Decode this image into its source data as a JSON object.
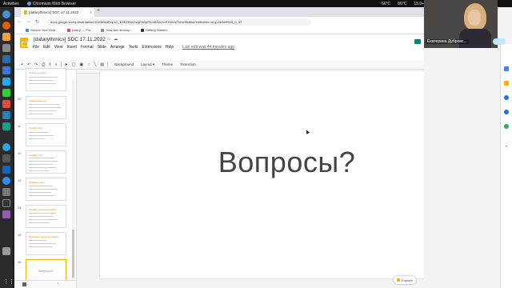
{
  "topbar": {
    "activities": "Activities",
    "app_name": "Chromium Web Browser",
    "status": [
      "66°C",
      "86°C",
      "15.0+"
    ]
  },
  "browser": {
    "tab_title": "[datarythmics] SDC 17.11.2022",
    "tab_close": "×",
    "new_tab": "+",
    "url": "docs.google.com/presentation/d/1K5D6aRnjrsC_E8EZbVaGvgZ4t0pPSmDWc2v-EVWvVTkhie6fs6tke/edit#slide=id.g19b0dfff330_0_57",
    "bookmarks": [
      {
        "label": "Secure Your Cold ...",
        "color": "#4285f4"
      },
      {
        "label": "pluto.jl — Plu...",
        "color": "#e44"
      },
      {
        "label": "How are develop...",
        "color": "#888"
      },
      {
        "label": "Getting Started...",
        "color": "#333"
      }
    ]
  },
  "slides": {
    "title": "[datarythmics] SDC 17.11.2022",
    "menu": [
      "File",
      "Edit",
      "View",
      "Insert",
      "Format",
      "Slide",
      "Arrange",
      "Tools",
      "Extensions",
      "Help"
    ],
    "last_edit": "Last edit was 44 minutes ago",
    "toolbar": {
      "background": "Background",
      "layout": "Layout ▾",
      "theme": "Theme",
      "transition": "Transition"
    },
    "thumbnails": [
      {
        "num": "",
        "title": "Плюсы ошибки",
        "lines": 3
      },
      {
        "num": "10",
        "title": "Главная мысль",
        "lines": 4
      },
      {
        "num": "11",
        "title": "Ошибки (HL)",
        "lines": 3
      },
      {
        "num": "12",
        "title": "Ошибки (HL)",
        "lines": 5
      },
      {
        "num": "13",
        "title": "Примеры (HL)",
        "lines": 4
      },
      {
        "num": "14",
        "title": "Ошибки (интерпретация)",
        "lines": 4
      },
      {
        "num": "15",
        "title": "Примеры (интерпретация)",
        "lines": 3
      },
      {
        "num": "16",
        "title": "",
        "center": "Вопросы?",
        "selected": true
      }
    ],
    "slide_text": "Вопросы?",
    "explore": "Explore"
  },
  "webcam": {
    "name": "Екатерина Дубровс..."
  }
}
